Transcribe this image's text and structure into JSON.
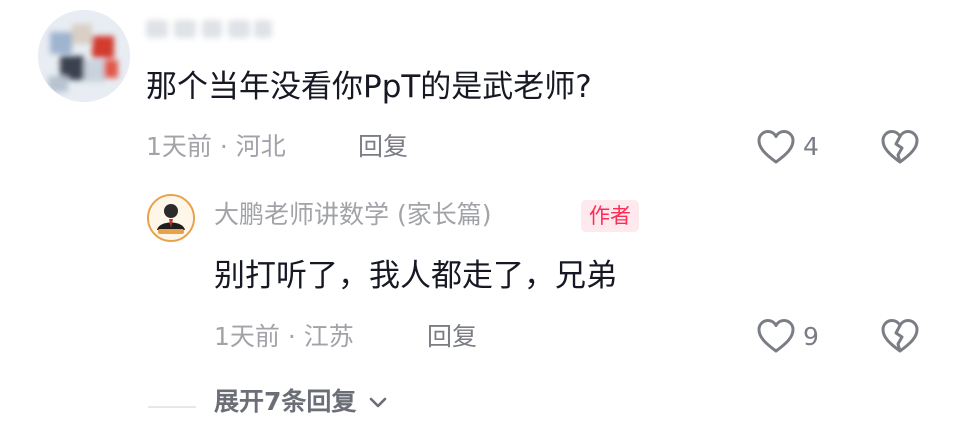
{
  "comment": {
    "text": "那个当年没看你PpT的是武老师?",
    "time": "1天前",
    "separator": " · ",
    "location": "河北",
    "reply_label": "回复",
    "like_count": "4"
  },
  "author_reply": {
    "author": "大鹏老师讲数学 (家长篇)",
    "badge": "作者",
    "text": "别打听了，我人都走了，兄弟",
    "time": "1天前",
    "separator": " · ",
    "location": "江苏",
    "reply_label": "回复",
    "like_count": "9"
  },
  "expand_label": "展开7条回复",
  "icons": {
    "like": "heart-outline-icon",
    "dislike": "broken-heart-icon",
    "expand": "chevron-down-icon"
  },
  "colors": {
    "primary_text": "#161823",
    "secondary_text": "#a1a3a8",
    "badge_text": "#fe2c55",
    "badge_bg": "#fde9ee"
  }
}
